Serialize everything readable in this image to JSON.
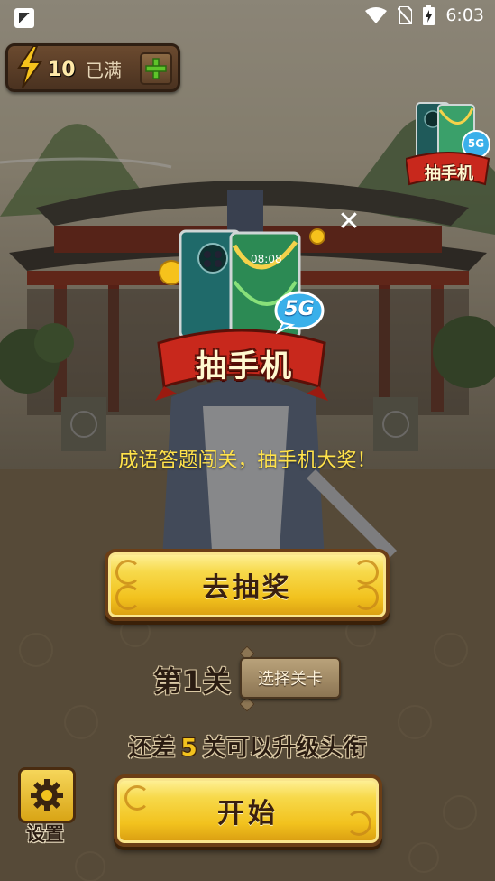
{
  "status_bar": {
    "time": "6:03",
    "icons": [
      "app-notification-icon",
      "wifi-icon",
      "no-sim-icon",
      "battery-charging-icon"
    ]
  },
  "energy": {
    "icon": "lightning-bolt-icon",
    "count": "10",
    "status": "已满",
    "add_icon": "plus-icon"
  },
  "promo": {
    "small_label": "抽手机",
    "small_badge": "5G",
    "big_label": "抽手机",
    "big_badge": "5G",
    "phone_time": "08:08",
    "tagline": "成语答题闯关，抽手机大奖！",
    "draw_button": "去抽奖",
    "close_icon": "close-icon"
  },
  "level": {
    "current": "第1关",
    "select_button": "选择关卡"
  },
  "upgrade": {
    "prefix": "还差",
    "count": "5",
    "suffix": "关可以升级头衔"
  },
  "start_button": "开始",
  "settings": {
    "icon": "gear-icon",
    "label": "设置"
  },
  "colors": {
    "gold": "#f2c21e",
    "tagline": "#ffe24a",
    "banner_red": "#c8281c",
    "brown": "#4a3220"
  }
}
